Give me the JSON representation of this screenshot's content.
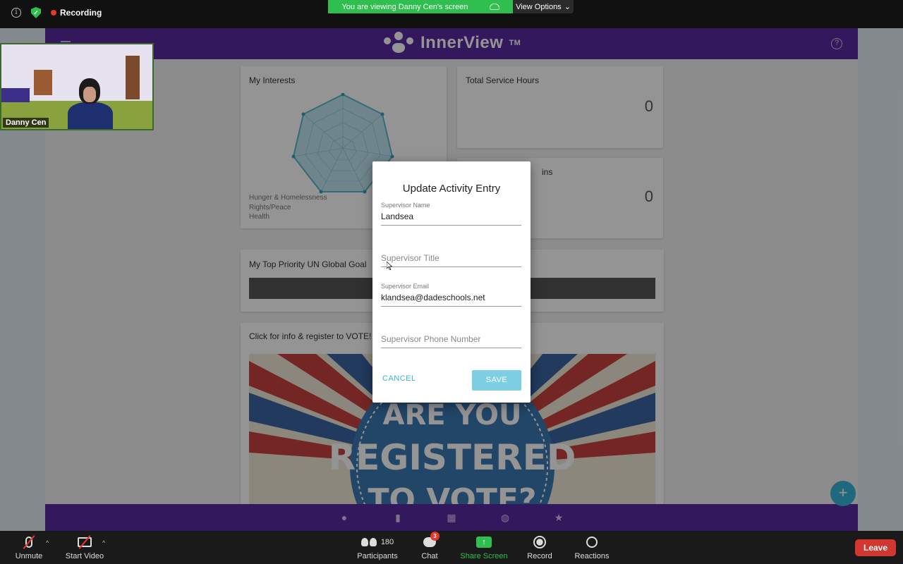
{
  "zoom_top": {
    "recording_label": "Recording",
    "viewing_banner": "You are viewing Danny Cen's screen",
    "view_options_label": "View Options"
  },
  "app": {
    "brand": "InnerView",
    "brand_tm": "TM",
    "brand_color": "#5b2aa0",
    "accent_color": "#37b5d6",
    "interests": {
      "title": "My Interests",
      "legend": [
        "Hunger & Homelessness",
        "Rights/Peace",
        "Health"
      ]
    },
    "service_hours": {
      "title": "Total Service Hours",
      "value": "0"
    },
    "second_stat": {
      "title_fragment": "ins",
      "value": "0"
    },
    "un_goal": {
      "title": "My Top Priority UN Global Goal"
    },
    "vote": {
      "title": "Click for info & register to VOTE!",
      "line1": "ARE YOU",
      "line2": "REGISTERED",
      "line3": "TO VOTE?"
    },
    "fab_symbol": "+"
  },
  "dialog": {
    "title": "Update Activity Entry",
    "supervisor_name_label": "Supervisor Name",
    "supervisor_name_value": "Landsea",
    "supervisor_title_placeholder": "Supervisor Title",
    "supervisor_email_label": "Supervisor Email",
    "supervisor_email_value": "klandsea@dadeschools.net",
    "supervisor_phone_placeholder": "Supervisor Phone Number",
    "cancel_label": "CANCEL",
    "save_label": "SAVE"
  },
  "video": {
    "participant_name": "Danny Cen"
  },
  "toolbar": {
    "unmute_label": "Unmute",
    "start_video_label": "Start Video",
    "participants_label": "Participants",
    "participants_count": "180",
    "chat_label": "Chat",
    "chat_badge": "3",
    "share_label": "Share Screen",
    "record_label": "Record",
    "reactions_label": "Reactions",
    "leave_label": "Leave"
  }
}
